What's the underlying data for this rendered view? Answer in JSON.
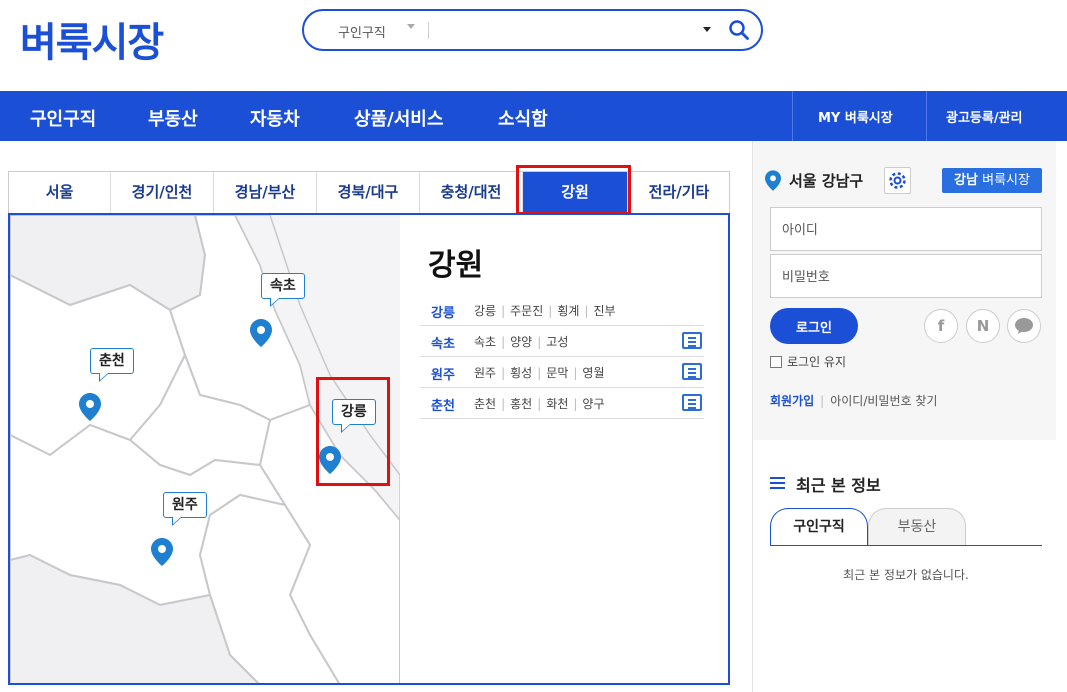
{
  "header": {
    "logo": "벼룩시장",
    "search": {
      "category": "구인구직",
      "value": ""
    }
  },
  "nav": {
    "items": [
      "구인구직",
      "부동산",
      "자동차",
      "상품/서비스",
      "소식함"
    ],
    "right": [
      "MY 벼룩시장",
      "광고등록/관리"
    ]
  },
  "region_tabs": {
    "items": [
      "서울",
      "경기/인천",
      "경남/부산",
      "경북/대구",
      "충청/대전",
      "강원",
      "전라/기타"
    ],
    "active": "강원"
  },
  "map": {
    "labels": [
      "속초",
      "춘천",
      "강릉",
      "원주"
    ]
  },
  "region_panel": {
    "title": "강원",
    "rows": [
      {
        "main": "강릉",
        "subs": [
          "강릉",
          "주문진",
          "횡계",
          "진부"
        ]
      },
      {
        "main": "속초",
        "subs": [
          "속초",
          "양양",
          "고성"
        ]
      },
      {
        "main": "원주",
        "subs": [
          "원주",
          "횡성",
          "문막",
          "영월"
        ]
      },
      {
        "main": "춘천",
        "subs": [
          "춘천",
          "홍천",
          "화천",
          "양구"
        ]
      }
    ]
  },
  "sidebar": {
    "location": "서울 강남구",
    "local_button": {
      "bold": "강남",
      "rest": "벼룩시장"
    },
    "id_placeholder": "아이디",
    "pw_placeholder": "비밀번호",
    "login_button": "로그인",
    "social": [
      "f",
      "N",
      "talk"
    ],
    "keep_login": "로그인 유지",
    "join": "회원가입",
    "find": "아이디/비밀번호 찾기",
    "recent_title": "최근 본 정보",
    "recent_tabs": [
      "구인구직",
      "부동산"
    ],
    "recent_empty": "최근 본 정보가 없습니다."
  },
  "colors": {
    "brand": "#1a4fd6",
    "pin": "#1f7fd0",
    "highlight": "#e01010"
  }
}
